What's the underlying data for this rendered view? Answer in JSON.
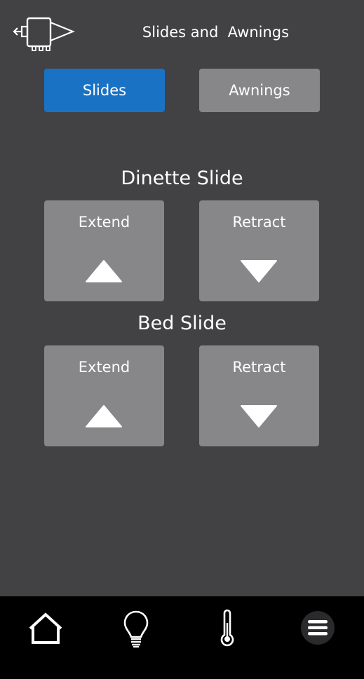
{
  "header": {
    "title": "Slides and  Awnings",
    "icon": "slide-out-camper-icon"
  },
  "tabs": [
    {
      "label": "Slides",
      "active": true
    },
    {
      "label": "Awnings",
      "active": false
    }
  ],
  "sections": [
    {
      "title": "Dinette Slide",
      "extend_label": "Extend",
      "retract_label": "Retract"
    },
    {
      "title": "Bed Slide",
      "extend_label": "Extend",
      "retract_label": "Retract"
    }
  ],
  "bottom_nav": [
    {
      "name": "home",
      "icon": "home-icon"
    },
    {
      "name": "lights",
      "icon": "lightbulb-icon"
    },
    {
      "name": "climate",
      "icon": "thermometer-icon"
    },
    {
      "name": "menu",
      "icon": "hamburger-menu-icon",
      "active": true
    }
  ],
  "colors": {
    "background": "#424244",
    "accent": "#1a72c5",
    "button": "#87878a",
    "nav_background": "#000000"
  }
}
